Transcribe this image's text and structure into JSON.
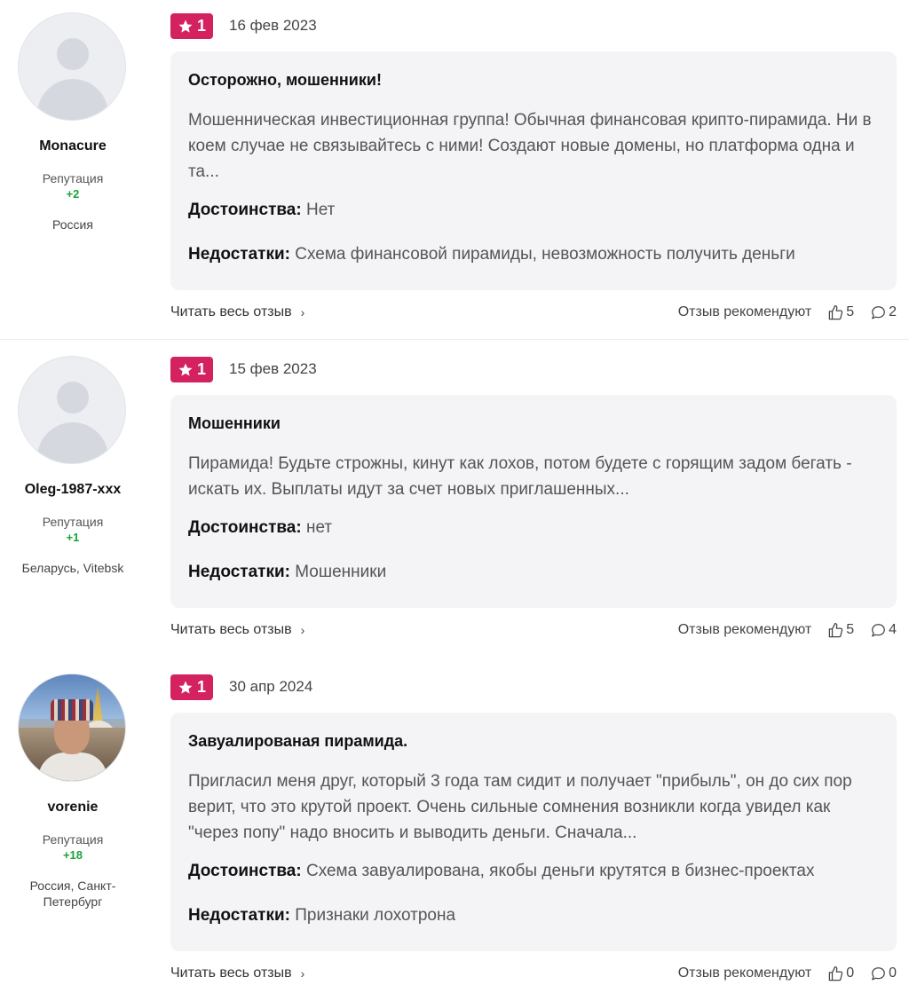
{
  "reviews": [
    {
      "author": {
        "name": "Monacure",
        "reputation_label": "Репутация",
        "reputation": "+2",
        "location": "Россия",
        "avatar": "default-avatar"
      },
      "rating": "1",
      "date": "16 фев 2023",
      "title": "Осторожно, мошенники!",
      "text": "Мошенническая инвестиционная группа! Обычная финансовая крипто-пирамида. Ни в коем случае не связывайтесь с ними! Создают новые домены, но платформа одна и та...",
      "pros_label": "Достоинства:",
      "pros": "Нет",
      "cons_label": "Недостатки:",
      "cons": "Схема финансовой пирамиды, невозможность получить деньги",
      "read_more": "Читать весь отзыв",
      "recommend_label": "Отзыв рекомендуют",
      "likes": "5",
      "comments": "2"
    },
    {
      "author": {
        "name": "Oleg-1987-xxx",
        "reputation_label": "Репутация",
        "reputation": "+1",
        "location": "Беларусь, Vitebsk",
        "avatar": "default-avatar"
      },
      "rating": "1",
      "date": "15 фев 2023",
      "title": "Мошенники",
      "text": "Пирамида! Будьте строжны, кинут как лохов, потом будете с горящим задом бегать - искать их. Выплаты идут за счет новых приглашенных...",
      "pros_label": "Достоинства:",
      "pros": "нет",
      "cons_label": "Недостатки:",
      "cons": "Мошенники",
      "read_more": "Читать весь отзыв",
      "recommend_label": "Отзыв рекомендуют",
      "likes": "5",
      "comments": "4"
    },
    {
      "author": {
        "name": "vorenie",
        "reputation_label": "Репутация",
        "reputation": "+18",
        "location": "Россия, Санкт-Петербург",
        "avatar": "photo-avatar"
      },
      "rating": "1",
      "date": "30 апр 2024",
      "title": "Завуалированая пирамида.",
      "text": "Пригласил меня друг, который 3 года там сидит и получает \"прибыль\", он до сих пор верит, что это крутой проект. Очень сильные сомнения возникли когда увидел как \"через попу\" надо вносить и выводить деньги. Сначала...",
      "pros_label": "Достоинства:",
      "pros": "Схема завуалирована, якобы деньги крутятся в бизнес-проектах",
      "cons_label": "Недостатки:",
      "cons": "Признаки лохотрона",
      "read_more": "Читать весь отзыв",
      "recommend_label": "Отзыв рекомендуют",
      "likes": "0",
      "comments": "0"
    }
  ],
  "colors": {
    "rating_badge": "#d4215f",
    "reputation_positive": "#1aa23a",
    "card_bg": "#f4f4f6"
  }
}
